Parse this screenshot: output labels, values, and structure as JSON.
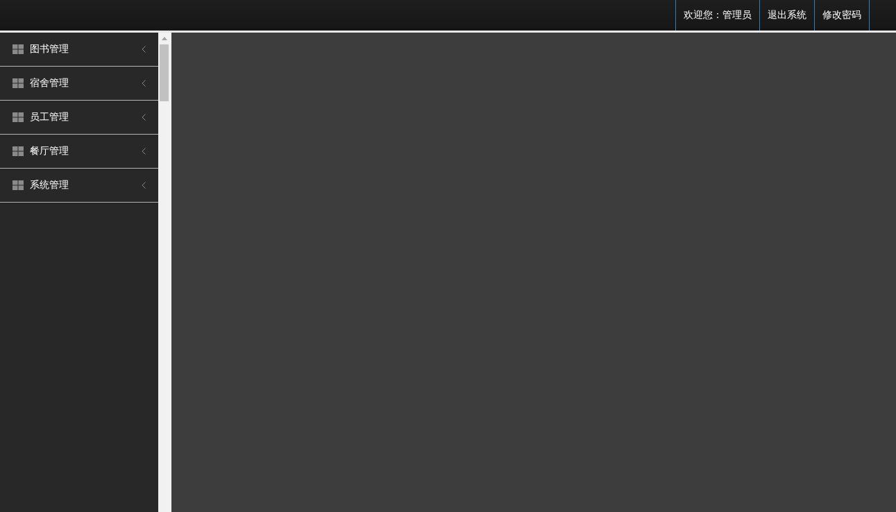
{
  "header": {
    "welcome": "欢迎您：管理员",
    "links": [
      "退出系统",
      "修改密码"
    ]
  },
  "sidebar": {
    "items": [
      {
        "label": "图书管理",
        "expanded": false
      },
      {
        "label": "宿舍管理",
        "expanded": false
      },
      {
        "label": "员工管理",
        "expanded": false
      },
      {
        "label": "餐厅管理",
        "expanded": false
      },
      {
        "label": "系统管理",
        "expanded": false
      }
    ]
  }
}
